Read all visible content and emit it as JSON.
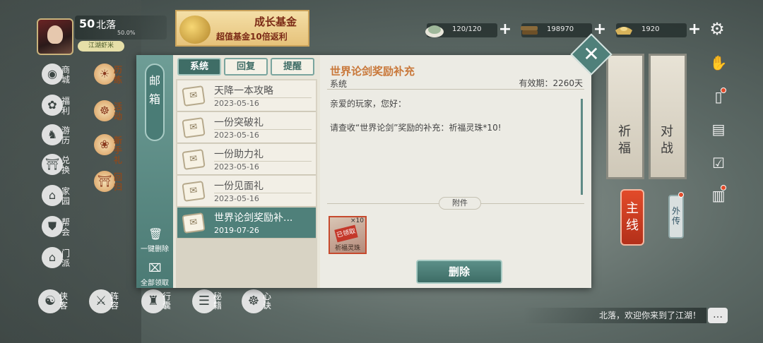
{
  "player": {
    "level": "50",
    "name": "北落",
    "exp_percent": "50.0%",
    "title": "江湖虾米"
  },
  "fund_banner": {
    "title": "成长基金",
    "subtitle": "超值基金10倍返利"
  },
  "resources": [
    {
      "icon": "rice-icon",
      "value": "120/120"
    },
    {
      "icon": "wood-icon",
      "value": "198970"
    },
    {
      "icon": "ingot-icon",
      "value": "1920"
    }
  ],
  "left_nav": [
    {
      "label": "商城",
      "icon": "shop-icon"
    },
    {
      "label": "福利",
      "icon": "gift-icon"
    },
    {
      "label": "游历",
      "icon": "horse-icon"
    },
    {
      "label": "兑换",
      "icon": "exchange-icon"
    },
    {
      "label": "家园",
      "icon": "home-icon"
    },
    {
      "label": "帮会",
      "icon": "guild-icon"
    },
    {
      "label": "门派",
      "icon": "sect-icon"
    }
  ],
  "left_nav2": [
    {
      "label": "历练",
      "icon": "training-icon"
    },
    {
      "label": "活动",
      "icon": "activity-icon"
    },
    {
      "label": "新手礼",
      "icon": "newbie-gift-icon"
    },
    {
      "label": "回归",
      "icon": "return-icon"
    }
  ],
  "bottom_nav": [
    {
      "label": "侠客",
      "icon": "hero-icon"
    },
    {
      "label": "阵容",
      "icon": "formation-icon"
    },
    {
      "label": "行囊",
      "icon": "bag-icon"
    },
    {
      "label": "秘籍",
      "icon": "book-icon"
    },
    {
      "label": "心诀",
      "icon": "mind-icon"
    }
  ],
  "right_banners": [
    {
      "label": "祈福"
    },
    {
      "label": "对战"
    }
  ],
  "main_quest": "主线",
  "side_story": "外传",
  "welcome_text": "北落，欢迎你来到了江湖！",
  "mail": {
    "title": "邮箱",
    "tabs": [
      "系统",
      "回复",
      "提醒"
    ],
    "delete_all_label": "一键删除",
    "collect_all_label": "全部领取",
    "items": [
      {
        "subject": "天降一本攻略",
        "date": "2023-05-16",
        "selected": false
      },
      {
        "subject": "一份突破礼",
        "date": "2023-05-16",
        "selected": false
      },
      {
        "subject": "一份助力礼",
        "date": "2023-05-16",
        "selected": false
      },
      {
        "subject": "一份见面礼",
        "date": "2023-05-16",
        "selected": false
      },
      {
        "subject": "世界论剑奖励补...",
        "date": "2019-07-26",
        "selected": true
      }
    ],
    "detail": {
      "title": "世界论剑奖励补充",
      "sender": "系统",
      "validity": "有效期：2260天",
      "greeting": "亲爱的玩家，您好：",
      "body": "请查收“世界论剑”奖励的补充：祈福灵珠*10!",
      "attachment_label": "附件",
      "attachment": {
        "name": "祈福灵珠",
        "count": "×10",
        "stamp": "已领取"
      },
      "delete_label": "删除"
    }
  }
}
